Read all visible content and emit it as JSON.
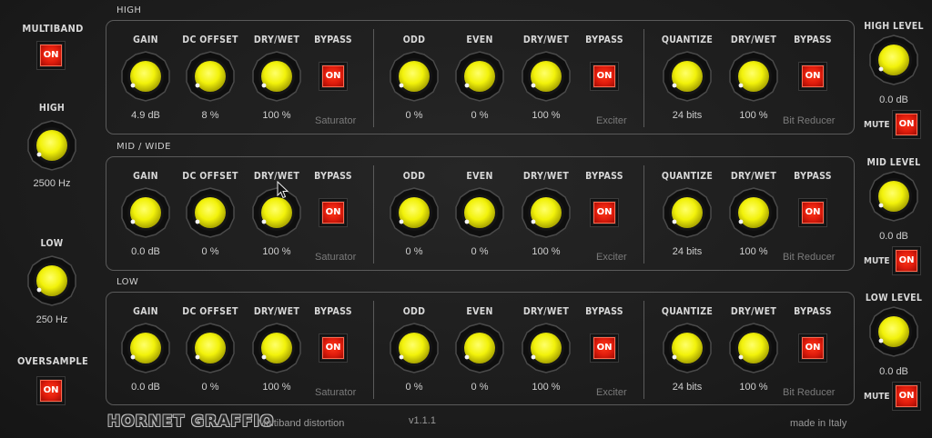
{
  "left": {
    "multiband_label": "MULTIBAND",
    "multiband_button": "ON",
    "high_label": "HIGH",
    "high_value": "2500 Hz",
    "low_label": "LOW",
    "low_value": "250 Hz",
    "oversample_label": "OVERSAMPLE",
    "oversample_button": "ON"
  },
  "bands": [
    {
      "title": "HIGH",
      "saturator": {
        "labels": [
          "GAIN",
          "DC OFFSET",
          "DRY/WET",
          "BYPASS"
        ],
        "values": [
          "4.9 dB",
          "8 %",
          "100 %"
        ],
        "bypass": "ON",
        "name": "Saturator"
      },
      "exciter": {
        "labels": [
          "ODD",
          "EVEN",
          "DRY/WET",
          "BYPASS"
        ],
        "values": [
          "0 %",
          "0 %",
          "100 %"
        ],
        "bypass": "ON",
        "name": "Exciter"
      },
      "bitreducer": {
        "labels": [
          "QUANTIZE",
          "DRY/WET",
          "BYPASS"
        ],
        "values": [
          "24 bits",
          "100 %"
        ],
        "bypass": "ON",
        "name": "Bit Reducer"
      },
      "level_label": "HIGH LEVEL",
      "level_value": "0.0 dB",
      "mute_label": "MUTE",
      "mute_button": "ON"
    },
    {
      "title": "MID / WIDE",
      "saturator": {
        "labels": [
          "GAIN",
          "DC OFFSET",
          "DRY/WET",
          "BYPASS"
        ],
        "values": [
          "0.0 dB",
          "0 %",
          "100 %"
        ],
        "bypass": "ON",
        "name": "Saturator"
      },
      "exciter": {
        "labels": [
          "ODD",
          "EVEN",
          "DRY/WET",
          "BYPASS"
        ],
        "values": [
          "0 %",
          "0 %",
          "100 %"
        ],
        "bypass": "ON",
        "name": "Exciter"
      },
      "bitreducer": {
        "labels": [
          "QUANTIZE",
          "DRY/WET",
          "BYPASS"
        ],
        "values": [
          "24 bits",
          "100 %"
        ],
        "bypass": "ON",
        "name": "Bit Reducer"
      },
      "level_label": "MID LEVEL",
      "level_value": "0.0 dB",
      "mute_label": "MUTE",
      "mute_button": "ON"
    },
    {
      "title": "LOW",
      "saturator": {
        "labels": [
          "GAIN",
          "DC OFFSET",
          "DRY/WET",
          "BYPASS"
        ],
        "values": [
          "0.0 dB",
          "0 %",
          "100 %"
        ],
        "bypass": "ON",
        "name": "Saturator"
      },
      "exciter": {
        "labels": [
          "ODD",
          "EVEN",
          "DRY/WET",
          "BYPASS"
        ],
        "values": [
          "0 %",
          "0 %",
          "100 %"
        ],
        "bypass": "ON",
        "name": "Exciter"
      },
      "bitreducer": {
        "labels": [
          "QUANTIZE",
          "DRY/WET",
          "BYPASS"
        ],
        "values": [
          "24 bits",
          "100 %"
        ],
        "bypass": "ON",
        "name": "Bit Reducer"
      },
      "level_label": "LOW LEVEL",
      "level_value": "0.0 dB",
      "mute_label": "MUTE",
      "mute_button": "ON"
    }
  ],
  "footer": {
    "brand": "HORNET GRAFFIO",
    "subtitle": "Multiband distortion",
    "version": "v1.1.1",
    "made_in": "made in Italy"
  },
  "colors": {
    "knob_yellow": "#f2f20a",
    "led_red": "#e01c0c",
    "background": "#1c1c1c",
    "panel_border": "#5a5a5a"
  },
  "icons": {
    "pointer": "mouse-pointer-icon"
  }
}
